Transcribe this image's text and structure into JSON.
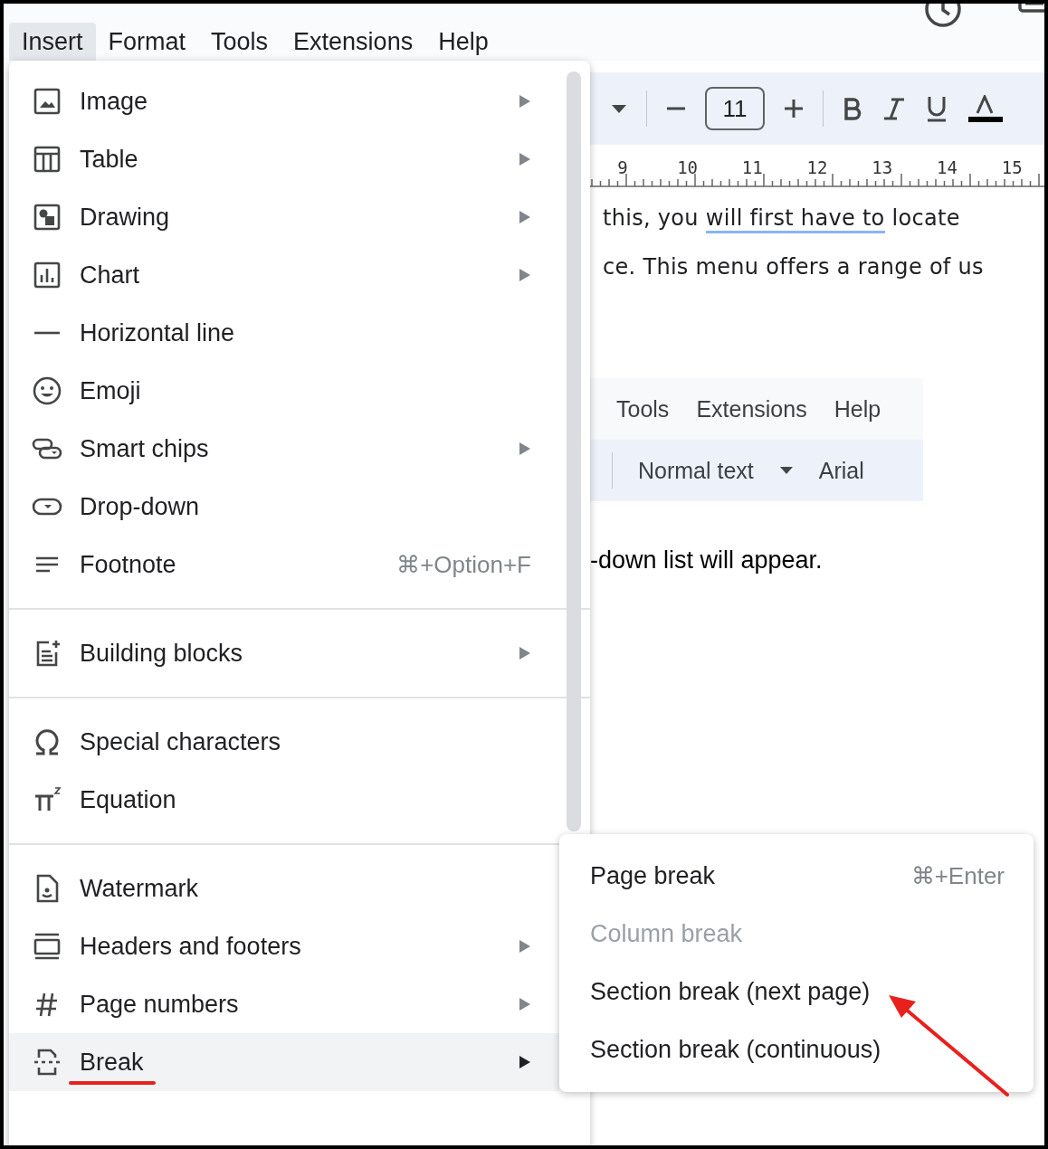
{
  "menubar": [
    {
      "label": "Insert",
      "selected": true
    },
    {
      "label": "Format",
      "selected": false
    },
    {
      "label": "Tools",
      "selected": false
    },
    {
      "label": "Extensions",
      "selected": false
    },
    {
      "label": "Help",
      "selected": false
    }
  ],
  "toolbar": {
    "font_size": "11"
  },
  "ruler": [
    "9",
    "10",
    "11",
    "12",
    "13",
    "14",
    "15"
  ],
  "document": {
    "line_1": {
      "before": "this, you ",
      "underlined": "will first have to",
      "after": " locate"
    },
    "line_2": "ce. This menu offers a range of us",
    "embedded_screenshot": {
      "menu": [
        "Tools",
        "Extensions",
        "Help"
      ],
      "style": "Normal text",
      "font": "Arial"
    },
    "line_3": "-down list will appear."
  },
  "insert_menu": {
    "groups": [
      [
        {
          "label": "Image",
          "submenu": true,
          "selected": false
        },
        {
          "label": "Table",
          "submenu": true,
          "selected": false
        },
        {
          "label": "Drawing",
          "submenu": true,
          "selected": false
        },
        {
          "label": "Chart",
          "submenu": true,
          "selected": false
        },
        {
          "label": "Horizontal line",
          "submenu": false,
          "selected": false
        },
        {
          "label": "Emoji",
          "submenu": false,
          "selected": false
        },
        {
          "label": "Smart chips",
          "submenu": true,
          "selected": false
        },
        {
          "label": "Drop-down",
          "submenu": false,
          "selected": false
        },
        {
          "label": "Footnote",
          "submenu": false,
          "shortcut": "⌘+Option+F",
          "selected": false
        }
      ],
      [
        {
          "label": "Building blocks",
          "submenu": true,
          "selected": false
        }
      ],
      [
        {
          "label": "Special characters",
          "submenu": false,
          "selected": false
        },
        {
          "label": "Equation",
          "submenu": false,
          "selected": false
        }
      ],
      [
        {
          "label": "Watermark",
          "submenu": false,
          "selected": false
        },
        {
          "label": "Headers and footers",
          "submenu": true,
          "selected": false
        },
        {
          "label": "Page numbers",
          "submenu": true,
          "selected": false
        },
        {
          "label": "Break",
          "submenu": true,
          "selected": true
        }
      ]
    ]
  },
  "break_submenu": {
    "items": [
      {
        "label": "Page break",
        "shortcut": "⌘+Enter",
        "disabled": false
      },
      {
        "label": "Column break",
        "disabled": true
      },
      {
        "label": "Section break (next page)",
        "disabled": false
      },
      {
        "label": "Section break (continuous)",
        "disabled": false
      }
    ]
  }
}
